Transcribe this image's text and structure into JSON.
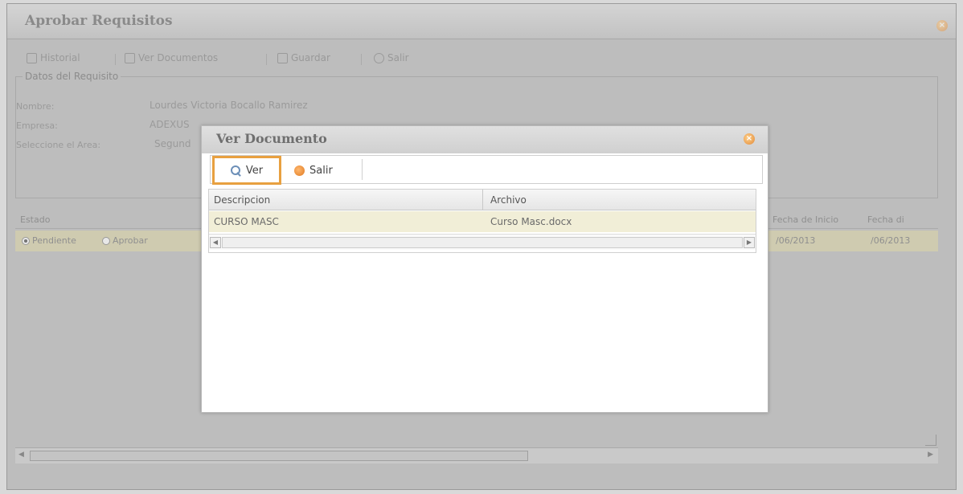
{
  "main_window": {
    "title": "Aprobar Requisitos",
    "toolbar": {
      "historial": "Historial",
      "ver_documentos": "Ver Documentos",
      "guardar": "Guardar",
      "salir": "Salir"
    },
    "fieldset": {
      "legend": "Datos del Requisito",
      "nombre_label": "Nombre:",
      "nombre_value": "Lourdes Victoria Bocallo Ramirez",
      "empresa_label": "Empresa:",
      "empresa_value": "ADEXUS",
      "area_label": "Seleccione el Area:",
      "area_value": "Segund"
    },
    "grid": {
      "estado_header": "Estado",
      "fecha_inicio_header": "Fecha de Inicio",
      "fecha_fin_header": "Fecha di",
      "radio_pendiente": "Pendiente",
      "radio_aprobar": "Aprobar",
      "fecha_inicio_value": "/06/2013",
      "fecha_fin_value": "/06/2013"
    }
  },
  "dialog": {
    "title": "Ver Documento",
    "toolbar": {
      "ver_label": "Ver",
      "salir_label": "Salir"
    },
    "columns": [
      "Descripcion",
      "Archivo"
    ],
    "rows": [
      {
        "descripcion": "CURSO MASC",
        "archivo": "Curso Masc.docx"
      }
    ]
  },
  "colors": {
    "highlight_border": "#e8a040",
    "selected_row": "#f1eed7",
    "overlay_gray": "#bdbdbd"
  }
}
